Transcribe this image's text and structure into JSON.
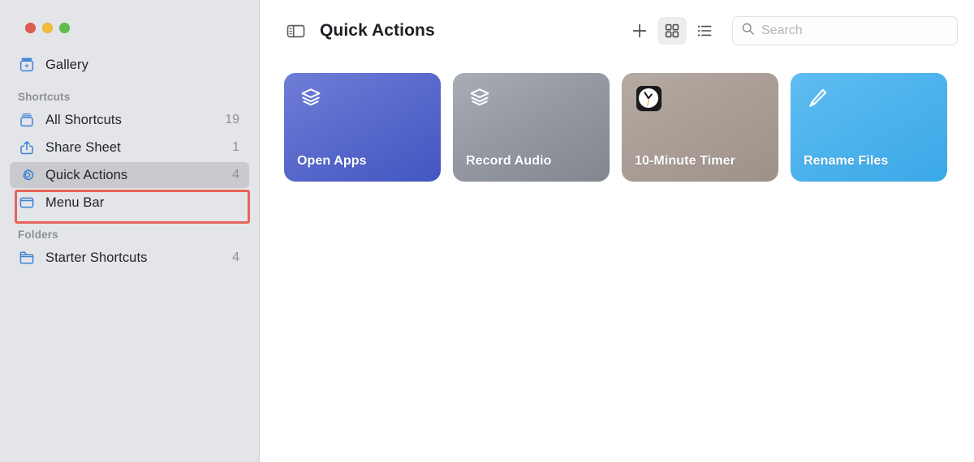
{
  "window": {
    "traffic_lights": [
      {
        "name": "close",
        "color": "#e05b51"
      },
      {
        "name": "minimize",
        "color": "#f2bb39"
      },
      {
        "name": "maximize",
        "color": "#5fbe4f"
      }
    ]
  },
  "sidebar": {
    "background": "#e4e5e9",
    "accent": "#3b82d6",
    "top_items": [
      {
        "label": "Gallery",
        "icon": "gallery-icon",
        "count": "",
        "selected": false
      }
    ],
    "sections": [
      {
        "header": "Shortcuts",
        "items": [
          {
            "label": "All Shortcuts",
            "icon": "all-shortcuts-icon",
            "count": "19",
            "selected": false
          },
          {
            "label": "Share Sheet",
            "icon": "share-sheet-icon",
            "count": "1",
            "selected": false
          },
          {
            "label": "Quick Actions",
            "icon": "gear-icon",
            "count": "4",
            "selected": true
          },
          {
            "label": "Menu Bar",
            "icon": "menu-bar-icon",
            "count": "",
            "selected": false
          }
        ]
      },
      {
        "header": "Folders",
        "items": [
          {
            "label": "Starter Shortcuts",
            "icon": "folder-icon",
            "count": "4",
            "selected": false
          }
        ]
      }
    ]
  },
  "annotation": {
    "name": "quick-actions-highlight",
    "color": "#e8645a",
    "target": "Quick Actions"
  },
  "toolbar": {
    "sidebar_toggle_icon": "sidebar-toggle-icon",
    "title": "Quick Actions",
    "add_icon": "plus-icon",
    "grid_view_icon": "grid-view-icon",
    "list_view_icon": "list-view-icon",
    "grid_view_active": true,
    "search": {
      "icon": "search-icon",
      "value": "",
      "placeholder": "Search"
    }
  },
  "main": {
    "view_mode": "grid",
    "cards": [
      {
        "label": "Open Apps",
        "icon": "layers-icon",
        "color_start": "#6b7ad4",
        "color_end": "#4558c4",
        "text_color": "#ffffff"
      },
      {
        "label": "Record Audio",
        "icon": "layers-icon",
        "color_start": "#a4a8b0",
        "color_end": "#868b94",
        "text_color": "#ffffff"
      },
      {
        "label": "10-Minute Timer",
        "icon": "clock-app-icon",
        "color_start": "#b2a79f",
        "color_end": "#a0948c",
        "text_color": "#ffffff"
      },
      {
        "label": "Rename Files",
        "icon": "pencil-icon",
        "color_start": "#59baf0",
        "color_end": "#3fabe8",
        "text_color": "#ffffff"
      }
    ]
  }
}
